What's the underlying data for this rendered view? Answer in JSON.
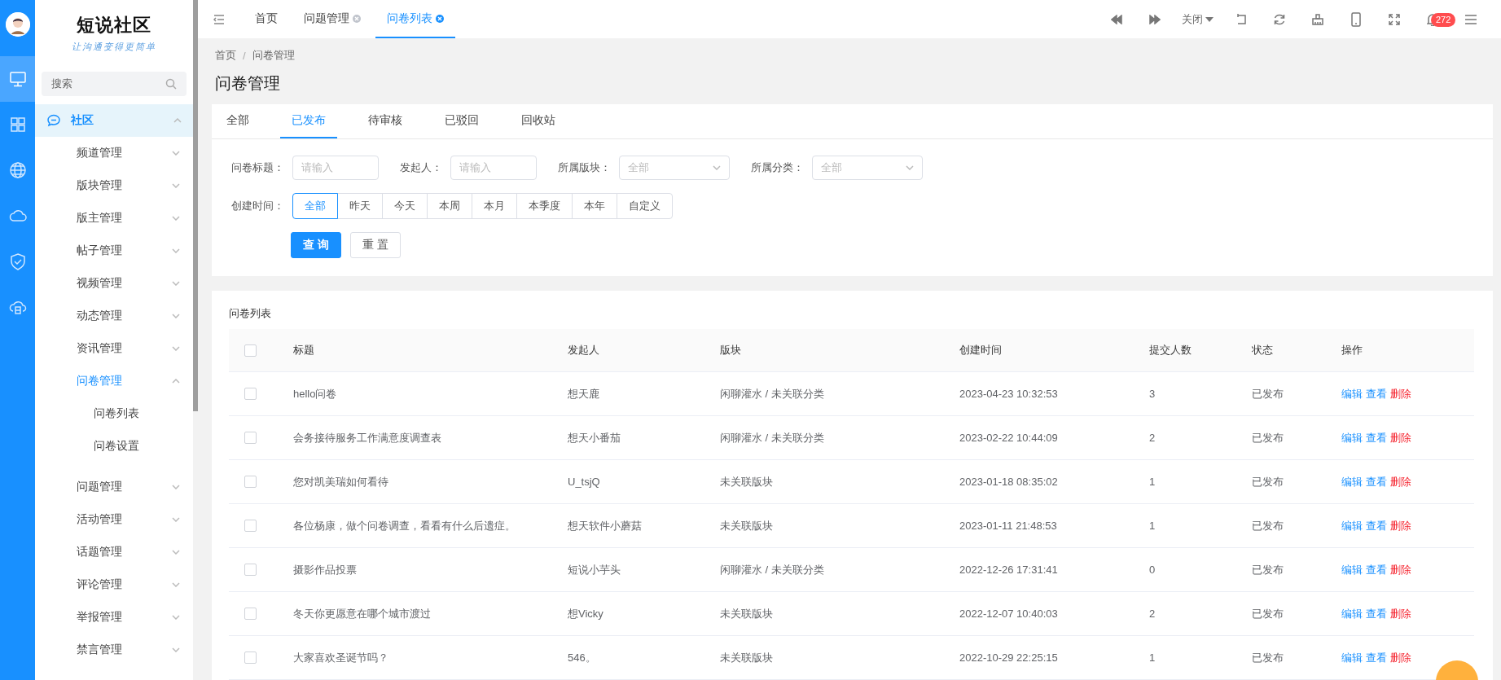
{
  "rail_items": [
    {
      "selected": true
    },
    {
      "selected": false
    },
    {
      "selected": false
    },
    {
      "selected": false
    },
    {
      "selected": false
    },
    {
      "selected": false
    }
  ],
  "logo": {
    "title": "短说社区",
    "subtitle": "让沟通变得更简单"
  },
  "sidebar": {
    "search_placeholder": "搜索",
    "menu": [
      {
        "label": "社区",
        "expanded": true,
        "children": [
          {
            "label": "频道管理",
            "expanded": false
          },
          {
            "label": "版块管理",
            "expanded": false
          },
          {
            "label": "版主管理",
            "expanded": false
          },
          {
            "label": "帖子管理",
            "expanded": false
          },
          {
            "label": "视频管理",
            "expanded": false
          },
          {
            "label": "动态管理",
            "expanded": false
          },
          {
            "label": "资讯管理",
            "expanded": false
          },
          {
            "label": "问卷管理",
            "expanded": true,
            "children": [
              {
                "label": "问卷列表"
              },
              {
                "label": "问卷设置"
              }
            ]
          },
          {
            "label": "问题管理",
            "expanded": false
          },
          {
            "label": "活动管理",
            "expanded": false
          },
          {
            "label": "话题管理",
            "expanded": false
          },
          {
            "label": "评论管理",
            "expanded": false
          },
          {
            "label": "举报管理",
            "expanded": false
          },
          {
            "label": "禁言管理",
            "expanded": false
          }
        ]
      }
    ]
  },
  "tabs": [
    {
      "label": "首页",
      "closable": false,
      "selected": false
    },
    {
      "label": "问题管理",
      "closable": true,
      "selected": false
    },
    {
      "label": "问卷列表",
      "closable": true,
      "selected": true
    }
  ],
  "toolbar": {
    "close_menu": "关闭",
    "notification_count": "272"
  },
  "breadcrumb": [
    "首页",
    "问卷管理"
  ],
  "breadcrumb_separator": "/",
  "page_title": "问卷管理",
  "status_tabs": [
    {
      "label": "全部",
      "selected": false
    },
    {
      "label": "已发布",
      "selected": true
    },
    {
      "label": "待审核",
      "selected": false
    },
    {
      "label": "已驳回",
      "selected": false
    },
    {
      "label": "回收站",
      "selected": false
    }
  ],
  "filters": [
    {
      "label": "问卷标题：",
      "kind": "input",
      "placeholder": "请输入"
    },
    {
      "label": "发起人：",
      "kind": "input",
      "placeholder": "请输入"
    },
    {
      "label": "所属版块：",
      "kind": "select",
      "placeholder": "全部"
    },
    {
      "label": "所属分类：",
      "kind": "select",
      "placeholder": "全部"
    }
  ],
  "date_filter": {
    "label": "创建时间：",
    "options": [
      {
        "label": "全部",
        "selected": true
      },
      {
        "label": "昨天",
        "selected": false
      },
      {
        "label": "今天",
        "selected": false
      },
      {
        "label": "本周",
        "selected": false
      },
      {
        "label": "本月",
        "selected": false
      },
      {
        "label": "本季度",
        "selected": false
      },
      {
        "label": "本年",
        "selected": false
      },
      {
        "label": "自定义",
        "selected": false
      }
    ]
  },
  "buttons": [
    {
      "label": "查询",
      "kind": "primary"
    },
    {
      "label": "重置",
      "kind": "default"
    }
  ],
  "table": {
    "title": "问卷列表",
    "header_checked": false,
    "columns": [
      "标题",
      "发起人",
      "版块",
      "创建时间",
      "提交人数",
      "状态",
      "操作"
    ],
    "rows": [
      {
        "checked": false,
        "cells": [
          "hello问卷",
          "想天鹿",
          "闲聊灌水 / 未关联分类",
          "2023-04-23 10:32:53",
          "3",
          "已发布"
        ],
        "actions": [
          {
            "label": "编辑",
            "kind": "link"
          },
          {
            "label": "查看",
            "kind": "link"
          },
          {
            "label": "删除",
            "kind": "danger"
          }
        ]
      },
      {
        "checked": false,
        "cells": [
          "会务接待服务工作满意度调查表",
          "想天小番茄",
          "闲聊灌水 / 未关联分类",
          "2023-02-22 10:44:09",
          "2",
          "已发布"
        ],
        "actions": [
          {
            "label": "编辑",
            "kind": "link"
          },
          {
            "label": "查看",
            "kind": "link"
          },
          {
            "label": "删除",
            "kind": "danger"
          }
        ]
      },
      {
        "checked": false,
        "cells": [
          "您对凯美瑞如何看待",
          "U_tsjQ",
          "未关联版块",
          "2023-01-18 08:35:02",
          "1",
          "已发布"
        ],
        "actions": [
          {
            "label": "编辑",
            "kind": "link"
          },
          {
            "label": "查看",
            "kind": "link"
          },
          {
            "label": "删除",
            "kind": "danger"
          }
        ]
      },
      {
        "checked": false,
        "cells": [
          "各位杨康，做个问卷调查，看看有什么后遗症。",
          "想天软件小蘑菇",
          "未关联版块",
          "2023-01-11 21:48:53",
          "1",
          "已发布"
        ],
        "actions": [
          {
            "label": "编辑",
            "kind": "link"
          },
          {
            "label": "查看",
            "kind": "link"
          },
          {
            "label": "删除",
            "kind": "danger"
          }
        ]
      },
      {
        "checked": false,
        "cells": [
          "摄影作品投票",
          "短说小芋头",
          "闲聊灌水 / 未关联分类",
          "2022-12-26 17:31:41",
          "0",
          "已发布"
        ],
        "actions": [
          {
            "label": "编辑",
            "kind": "link"
          },
          {
            "label": "查看",
            "kind": "link"
          },
          {
            "label": "删除",
            "kind": "danger"
          }
        ]
      },
      {
        "checked": false,
        "cells": [
          "冬天你更愿意在哪个城市渡过",
          "想Vicky",
          "未关联版块",
          "2022-12-07 10:40:03",
          "2",
          "已发布"
        ],
        "actions": [
          {
            "label": "编辑",
            "kind": "link"
          },
          {
            "label": "查看",
            "kind": "link"
          },
          {
            "label": "删除",
            "kind": "danger"
          }
        ]
      },
      {
        "checked": false,
        "cells": [
          "大家喜欢圣诞节吗？",
          "546。",
          "未关联版块",
          "2022-10-29 22:25:15",
          "1",
          "已发布"
        ],
        "actions": [
          {
            "label": "编辑",
            "kind": "link"
          },
          {
            "label": "查看",
            "kind": "link"
          },
          {
            "label": "删除",
            "kind": "danger"
          }
        ]
      }
    ]
  }
}
